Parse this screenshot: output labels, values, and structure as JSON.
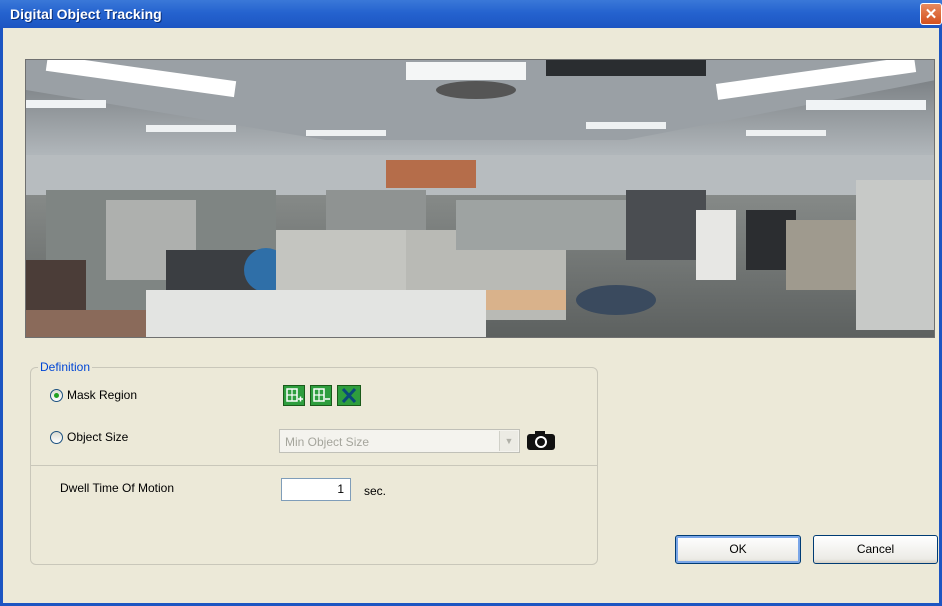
{
  "window": {
    "title": "Digital Object Tracking",
    "close_symbol": "✕"
  },
  "preview": {
    "description_icon": "camera-panorama-image"
  },
  "definition": {
    "legend": "Definition",
    "mask_region": {
      "label": "Mask Region",
      "selected": true
    },
    "object_size": {
      "label": "Object Size",
      "selected": false
    },
    "mask_tools": [
      "add-region-icon",
      "remove-region-icon",
      "clear-region-icon"
    ],
    "object_size_select": {
      "value": "Min Object Size",
      "arrow": "▼"
    },
    "snapshot_icon": "camera-icon"
  },
  "dwell": {
    "label": "Dwell Time Of Motion",
    "value": "1",
    "unit": "sec."
  },
  "buttons": {
    "ok": "OK",
    "cancel": "Cancel"
  }
}
